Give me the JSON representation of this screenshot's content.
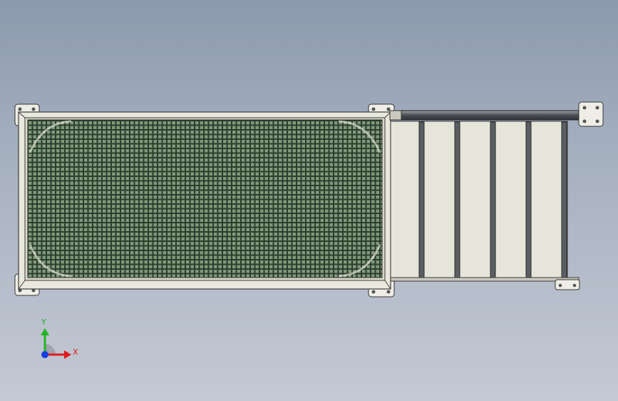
{
  "viewport": {
    "background_top": "#8c9aad",
    "background_bottom": "#c4c9d4"
  },
  "model": {
    "frame_color": "#e9e8dc",
    "frame_outline": "#3c3c3c",
    "mesh_color": "#6f8f6b",
    "panel_color": "#e6e5da",
    "roller_color": "#5a5f63",
    "slat_count": 5
  },
  "triad": {
    "x_label": "X",
    "y_label": "Y",
    "x_color": "#e01b1b",
    "y_color": "#22b422",
    "z_color": "#1b3ee0"
  }
}
